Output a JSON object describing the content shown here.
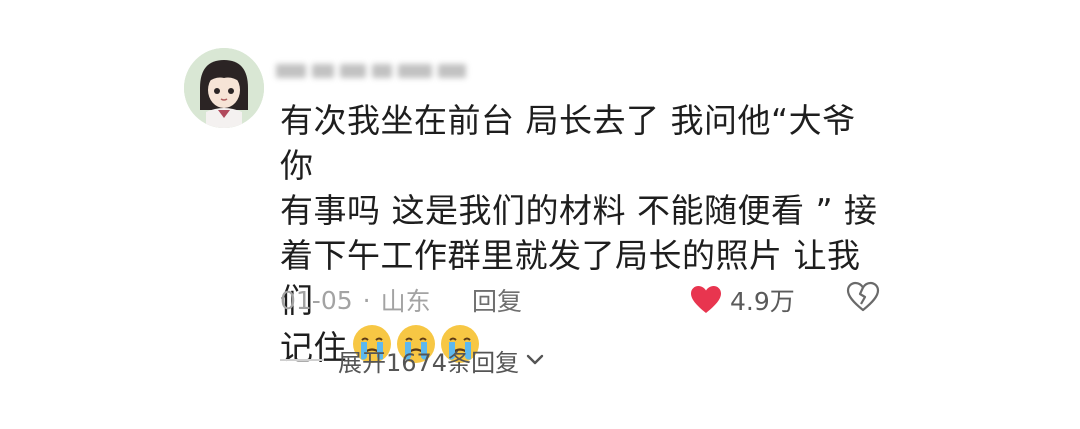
{
  "comment": {
    "avatar_icon": "anime-girl-avatar-icon",
    "username_hidden": true,
    "lines": [
      "有次我坐在前台 局长去了 我问他“大爷你",
      "有事吗 这是我们的材料 不能随便看 ” 接",
      "着下午工作群里就发了局长的照片 让我们",
      "记住"
    ],
    "emojis": [
      "crying-face-icon",
      "crying-face-icon",
      "crying-face-icon"
    ],
    "date": "01-05",
    "separator": "·",
    "location": "山东",
    "reply_label": "回复",
    "like_count": "4.9万",
    "like_icon": "heart-icon",
    "dislike_icon": "broken-heart-icon",
    "expand_label": "展开1674条回复",
    "expand_icon": "chevron-down-icon"
  },
  "colors": {
    "text": "#1e1e1e",
    "meta": "#a3a3a3",
    "like": "#e8354f"
  }
}
